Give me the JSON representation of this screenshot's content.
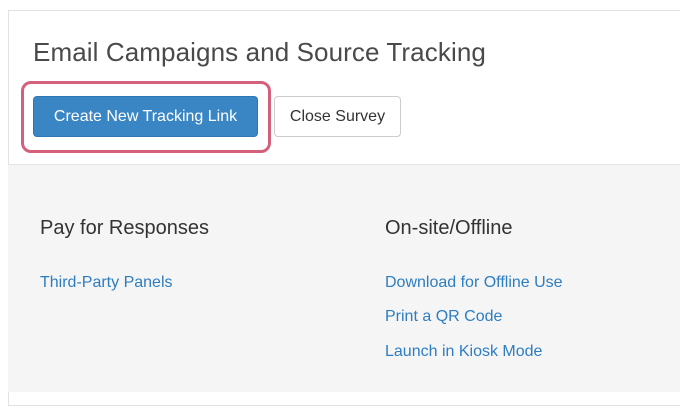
{
  "page": {
    "title": "Email Campaigns and Source Tracking"
  },
  "actions": {
    "create_label": "Create New Tracking Link",
    "close_label": "Close Survey"
  },
  "colors": {
    "primary": "#3a86c4",
    "highlight": "#d4607c",
    "link": "#2d7dc1",
    "panel_background": "#f5f5f5"
  },
  "sections": [
    {
      "title": "Pay for Responses",
      "links": [
        "Third-Party Panels"
      ]
    },
    {
      "title": "On-site/Offline",
      "links": [
        "Download for Offline Use",
        "Print a QR Code",
        "Launch in Kiosk Mode"
      ]
    }
  ]
}
